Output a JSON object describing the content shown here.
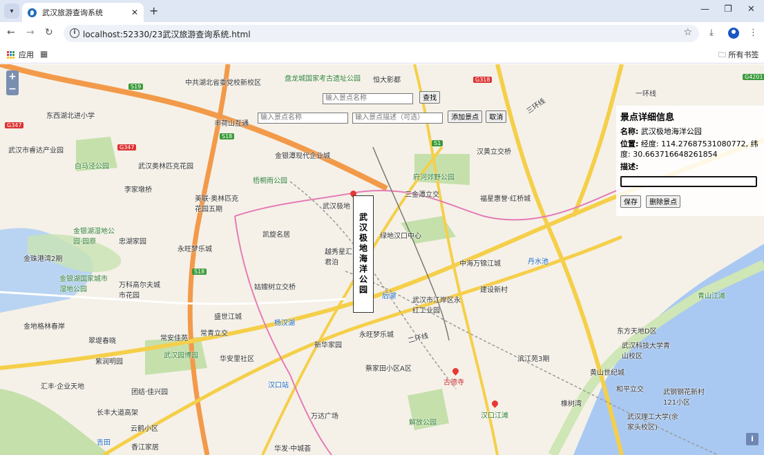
{
  "browser": {
    "tab_title": "武汉旅游查询系统",
    "url": "localhost:52330/23武汉旅游查询系统.html",
    "bookmarks_apps": "应用",
    "bookmarks_all": "所有书签"
  },
  "controls": {
    "search_placeholder": "输入景点名称",
    "search_button": "查找",
    "add_name_placeholder": "输入景点名称",
    "add_desc_placeholder": "输入景点描述（可选）",
    "add_button": "添加景点",
    "cancel_button": "取消"
  },
  "detail": {
    "heading": "景点详细信息",
    "name_label": "名称:",
    "name_value": "武汉极地海洋公园",
    "position_label": "位置:",
    "position_value": "经度: 114.27687531080772, 纬度: 30.663716648261854",
    "desc_label": "描述:",
    "save_button": "保存",
    "delete_button": "删除景点"
  },
  "popup_label": "武汉极地海洋公园",
  "map_labels": [
    {
      "text": "中共湖北省委党校新校区",
      "cls": ""
    },
    {
      "text": "盘龙城国家考古遗址公园",
      "cls": "green"
    },
    {
      "text": "恒大影都",
      "cls": ""
    },
    {
      "text": "东西湖北进小学",
      "cls": ""
    },
    {
      "text": "丰荷山互通",
      "cls": ""
    },
    {
      "text": "武汉市睿达产业园",
      "cls": ""
    },
    {
      "text": "白马泾公园",
      "cls": "green"
    },
    {
      "text": "武汉奥林匹克花园",
      "cls": ""
    },
    {
      "text": "金银潭现代企业城",
      "cls": ""
    },
    {
      "text": "梧桐雨公园",
      "cls": "green"
    },
    {
      "text": "李家墩桥",
      "cls": ""
    },
    {
      "text": "汉黄立交桥",
      "cls": ""
    },
    {
      "text": "府河郊野公园",
      "cls": "green"
    },
    {
      "text": "三金潭立交",
      "cls": ""
    },
    {
      "text": "福星惠誉·红桥城",
      "cls": ""
    },
    {
      "text": "美联·奥林匹克花园五期",
      "cls": ""
    },
    {
      "text": "武汉极地",
      "cls": ""
    },
    {
      "text": "金银湖湿地公园·园原",
      "cls": "green"
    },
    {
      "text": "凯旋名居",
      "cls": ""
    },
    {
      "text": "忠湖家园",
      "cls": ""
    },
    {
      "text": "绿地汉口中心",
      "cls": ""
    },
    {
      "text": "永旺梦乐城",
      "cls": ""
    },
    {
      "text": "越秀星汇君泊",
      "cls": ""
    },
    {
      "text": "金珠港湾2期",
      "cls": ""
    },
    {
      "text": "中海万锦江城",
      "cls": ""
    },
    {
      "text": "丹水池",
      "cls": "blue"
    },
    {
      "text": "金银湖国家城市湿地公园",
      "cls": "green"
    },
    {
      "text": "万科高尔夫城市花园",
      "cls": ""
    },
    {
      "text": "姑嫂树立交桥",
      "cls": ""
    },
    {
      "text": "建设新村",
      "cls": ""
    },
    {
      "text": "武汉市江岸区永红工业园",
      "cls": ""
    },
    {
      "text": "后湖",
      "cls": "blue"
    },
    {
      "text": "盛世江城",
      "cls": ""
    },
    {
      "text": "青山江滩",
      "cls": "green"
    },
    {
      "text": "杨汉湖",
      "cls": "blue"
    },
    {
      "text": "金地格林春岸",
      "cls": ""
    },
    {
      "text": "常青立交",
      "cls": ""
    },
    {
      "text": "永旺梦乐城",
      "cls": ""
    },
    {
      "text": "东方天地D区",
      "cls": ""
    },
    {
      "text": "翠堤春晓",
      "cls": ""
    },
    {
      "text": "常安佳苑",
      "cls": ""
    },
    {
      "text": "新华家园",
      "cls": ""
    },
    {
      "text": "武汉科技大学青山校区",
      "cls": ""
    },
    {
      "text": "紫润明园",
      "cls": ""
    },
    {
      "text": "武汉园博园",
      "cls": "green"
    },
    {
      "text": "华安里社区",
      "cls": ""
    },
    {
      "text": "滨江苑3期",
      "cls": ""
    },
    {
      "text": "蔡家田小区A区",
      "cls": ""
    },
    {
      "text": "黄山世纪城",
      "cls": ""
    },
    {
      "text": "汇丰·企业天地",
      "cls": ""
    },
    {
      "text": "团结·佳兴园",
      "cls": ""
    },
    {
      "text": "汉口站",
      "cls": "blue"
    },
    {
      "text": "古德寺",
      "cls": "red"
    },
    {
      "text": "和平立交",
      "cls": ""
    },
    {
      "text": "武钢钢花新村121小区",
      "cls": ""
    },
    {
      "text": "橡树湾",
      "cls": ""
    },
    {
      "text": "长丰大道高架",
      "cls": ""
    },
    {
      "text": "万达广场",
      "cls": ""
    },
    {
      "text": "解放公园",
      "cls": "green"
    },
    {
      "text": "汉口江滩",
      "cls": "green"
    },
    {
      "text": "武汉理工大学(余家头校区)",
      "cls": ""
    },
    {
      "text": "云鹤小区",
      "cls": ""
    },
    {
      "text": "香江家居",
      "cls": ""
    },
    {
      "text": "华发·中城荟",
      "cls": ""
    },
    {
      "text": "吉田",
      "cls": "blue"
    },
    {
      "text": "三环线",
      "cls": ""
    },
    {
      "text": "二环线",
      "cls": ""
    },
    {
      "text": "一环线",
      "cls": ""
    }
  ],
  "road_tags": [
    "S19",
    "G318",
    "G347",
    "G347",
    "S18",
    "S1",
    "S18",
    "G4201"
  ],
  "colors": {
    "road_orange": "#f29a4a",
    "road_yellow": "#f5cf4a",
    "water": "#a6c8f0",
    "park": "#c7e3b0",
    "rail": "#e57bb5"
  }
}
